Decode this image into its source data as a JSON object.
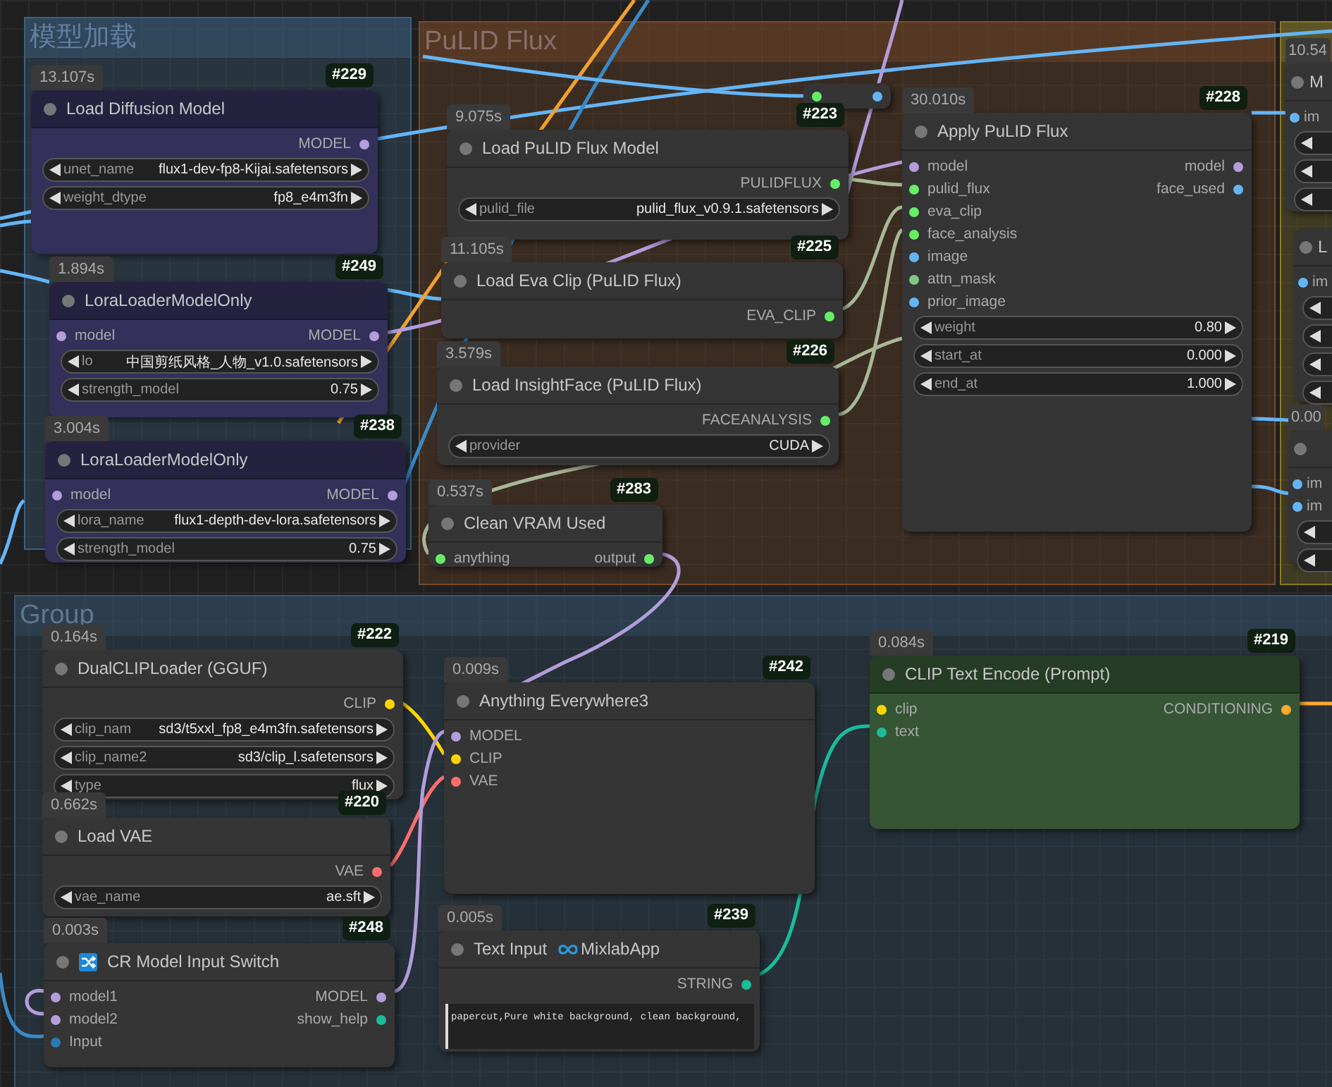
{
  "groups": [
    {
      "title": "模型加载",
      "color": "#3b6284"
    },
    {
      "title": "PuLID Flux",
      "color": "#7a4a28"
    },
    {
      "color": "#8a7a2a"
    },
    {
      "title": "Group",
      "color": "#36556f"
    }
  ],
  "nodes": [
    {
      "kind": "node",
      "color": "#33305a",
      "time": "13.107s",
      "id": "#229",
      "title": "Load Diffusion Model",
      "outputs": [
        {
          "label": "MODEL",
          "color": "#b39ddb"
        }
      ],
      "widgets": [
        {
          "kind": "combo",
          "label": "unet_name",
          "value": "flux1-dev-fp8-Kijai.safetensors"
        },
        {
          "kind": "combo",
          "label": "weight_dtype",
          "value": "fp8_e4m3fn"
        }
      ]
    },
    {
      "kind": "node",
      "color": "#33305a",
      "time": "1.894s",
      "id": "#249",
      "title": "LoraLoaderModelOnly",
      "inputs": [
        {
          "label": "model",
          "color": "#b39ddb"
        }
      ],
      "outputs": [
        {
          "label": "MODEL",
          "color": "#b39ddb"
        }
      ],
      "widgets": [
        {
          "kind": "combo",
          "label": "lo",
          "value": "中国剪纸风格_人物_v1.0.safetensors"
        },
        {
          "kind": "combo",
          "label": "strength_model",
          "value": "0.75"
        }
      ]
    },
    {
      "kind": "node",
      "color": "#33305a",
      "time": "3.004s",
      "id": "#238",
      "title": "LoraLoaderModelOnly",
      "inputs": [
        {
          "label": "model",
          "color": "#b39ddb"
        }
      ],
      "outputs": [
        {
          "label": "MODEL",
          "color": "#b39ddb"
        }
      ],
      "widgets": [
        {
          "kind": "combo",
          "label": "lora_name",
          "value": "flux1-depth-dev-lora.safetensors"
        },
        {
          "kind": "combo",
          "label": "strength_model",
          "value": "0.75"
        }
      ]
    },
    {
      "kind": "reroute",
      "color": "#353535",
      "inputs": [
        {
          "color": "#66ee66"
        }
      ],
      "outputs": [
        {
          "color": "#64b5f6"
        }
      ]
    },
    {
      "kind": "node",
      "color": "#353535",
      "time": "9.075s",
      "id": "#223",
      "title": "Load PuLID Flux Model",
      "outputs": [
        {
          "label": "PULIDFLUX",
          "color": "#66ee66"
        }
      ],
      "widgets": [
        {
          "kind": "combo",
          "label": "pulid_file",
          "value": "pulid_flux_v0.9.1.safetensors"
        }
      ]
    },
    {
      "kind": "node",
      "color": "#353535",
      "time": "11.105s",
      "id": "#225",
      "title": "Load Eva Clip (PuLID Flux)",
      "outputs": [
        {
          "label": "EVA_CLIP",
          "color": "#66ee66"
        }
      ]
    },
    {
      "kind": "node",
      "color": "#353535",
      "time": "3.579s",
      "id": "#226",
      "title": "Load InsightFace (PuLID Flux)",
      "outputs": [
        {
          "label": "FACEANALYSIS",
          "color": "#66ee66"
        }
      ],
      "widgets": [
        {
          "kind": "combo",
          "label": "provider",
          "value": "CUDA"
        }
      ]
    },
    {
      "kind": "node",
      "color": "#353535",
      "time": "0.537s",
      "id": "#283",
      "title": "Clean VRAM Used",
      "inputs": [
        {
          "label": "anything",
          "color": "#66ee66"
        }
      ],
      "outputs": [
        {
          "label": "output",
          "color": "#66ee66"
        }
      ]
    },
    {
      "kind": "node",
      "color": "#353535",
      "time": "30.010s",
      "id": "#228",
      "title": "Apply PuLID Flux",
      "inputs": [
        {
          "label": "model",
          "color": "#b39ddb"
        },
        {
          "label": "pulid_flux",
          "color": "#66ee66"
        },
        {
          "label": "eva_clip",
          "color": "#66ee66"
        },
        {
          "label": "face_analysis",
          "color": "#66ee66"
        },
        {
          "label": "image",
          "color": "#64b5f6"
        },
        {
          "label": "attn_mask",
          "color": "#81c784"
        },
        {
          "label": "prior_image",
          "color": "#64b5f6"
        }
      ],
      "outputs": [
        {
          "label": "model",
          "color": "#b39ddb"
        },
        {
          "label": "face_used",
          "color": "#64b5f6"
        }
      ],
      "widgets": [
        {
          "kind": "combo",
          "label": "weight",
          "value": "0.80"
        },
        {
          "kind": "combo",
          "label": "start_at",
          "value": "0.000"
        },
        {
          "kind": "combo",
          "label": "end_at",
          "value": "1.000"
        }
      ]
    },
    {
      "kind": "node",
      "color": "#353535",
      "time": "10.54",
      "title": "M",
      "inputs": [
        {
          "label": "im",
          "color": "#64b5f6"
        }
      ],
      "widgets": [
        {
          "kind": "combo"
        },
        {
          "kind": "combo"
        },
        {
          "kind": "combo"
        }
      ]
    },
    {
      "kind": "node",
      "color": "#353535",
      "title": "L",
      "inputs": [
        {
          "label": "im",
          "color": "#64b5f6"
        }
      ],
      "widgets": [
        {
          "kind": "combo"
        },
        {
          "kind": "combo"
        },
        {
          "kind": "combo"
        },
        {
          "kind": "combo"
        }
      ]
    },
    {
      "kind": "node",
      "color": "#353535",
      "time": "0.00",
      "inputs": [
        {
          "label": "im",
          "color": "#64b5f6"
        },
        {
          "label": "im",
          "color": "#64b5f6"
        }
      ],
      "widgets": [
        {
          "kind": "combo"
        },
        {
          "kind": "combo"
        }
      ]
    },
    {
      "kind": "node",
      "color": "#353535",
      "time": "0.164s",
      "id": "#222",
      "title": "DualCLIPLoader (GGUF)",
      "outputs": [
        {
          "label": "CLIP",
          "color": "#ffd500"
        }
      ],
      "widgets": [
        {
          "kind": "combo",
          "label": "clip_nam",
          "value": "sd3/t5xxl_fp8_e4m3fn.safetensors"
        },
        {
          "kind": "combo",
          "label": "clip_name2",
          "value": "sd3/clip_l.safetensors"
        },
        {
          "kind": "combo",
          "label": "type",
          "value": "flux"
        }
      ]
    },
    {
      "kind": "node",
      "color": "#353535",
      "time": "0.662s",
      "id": "#220",
      "title": "Load VAE",
      "outputs": [
        {
          "label": "VAE",
          "color": "#ff6e6e"
        }
      ],
      "widgets": [
        {
          "kind": "combo",
          "label": "vae_name",
          "value": "ae.sft"
        }
      ]
    },
    {
      "kind": "node",
      "color": "#353535",
      "time": "0.003s",
      "id": "#248",
      "title_icon": {
        "kind": "shuffle"
      },
      "title": "CR Model Input Switch",
      "inputs": [
        {
          "label": "model1",
          "color": "#b39ddb"
        },
        {
          "label": "model2",
          "color": "#b39ddb"
        },
        {
          "label": "Input",
          "color": "#2a7ab8"
        }
      ],
      "outputs": [
        {
          "label": "MODEL",
          "color": "#b39ddb"
        },
        {
          "label": "show_help",
          "color": "#1abc9c"
        }
      ]
    },
    {
      "kind": "node",
      "color": "#353535",
      "time": "0.009s",
      "id": "#242",
      "title": "Anything Everywhere3",
      "inputs": [
        {
          "label": "MODEL",
          "color": "#b39ddb"
        },
        {
          "label": "CLIP",
          "color": "#ffd500"
        },
        {
          "label": "VAE",
          "color": "#ff6e6e"
        }
      ]
    },
    {
      "kind": "node",
      "color": "#353535",
      "time": "0.005s",
      "id": "#239",
      "title": "Text Input",
      "suffix_icon": {
        "kind": "infinity"
      },
      "suffix": "MixlabApp",
      "outputs": [
        {
          "label": "STRING",
          "color": "#1abc9c"
        }
      ],
      "text": "papercut,Pure white background, clean background,"
    },
    {
      "kind": "node",
      "color": "#355535",
      "time": "0.084s",
      "id": "#219",
      "title": "CLIP Text Encode (Prompt)",
      "inputs": [
        {
          "label": "clip",
          "color": "#ffd500"
        },
        {
          "label": "text",
          "color": "#1abc9c"
        }
      ],
      "outputs": [
        {
          "label": "CONDITIONING",
          "color": "#ffa931"
        }
      ]
    }
  ]
}
